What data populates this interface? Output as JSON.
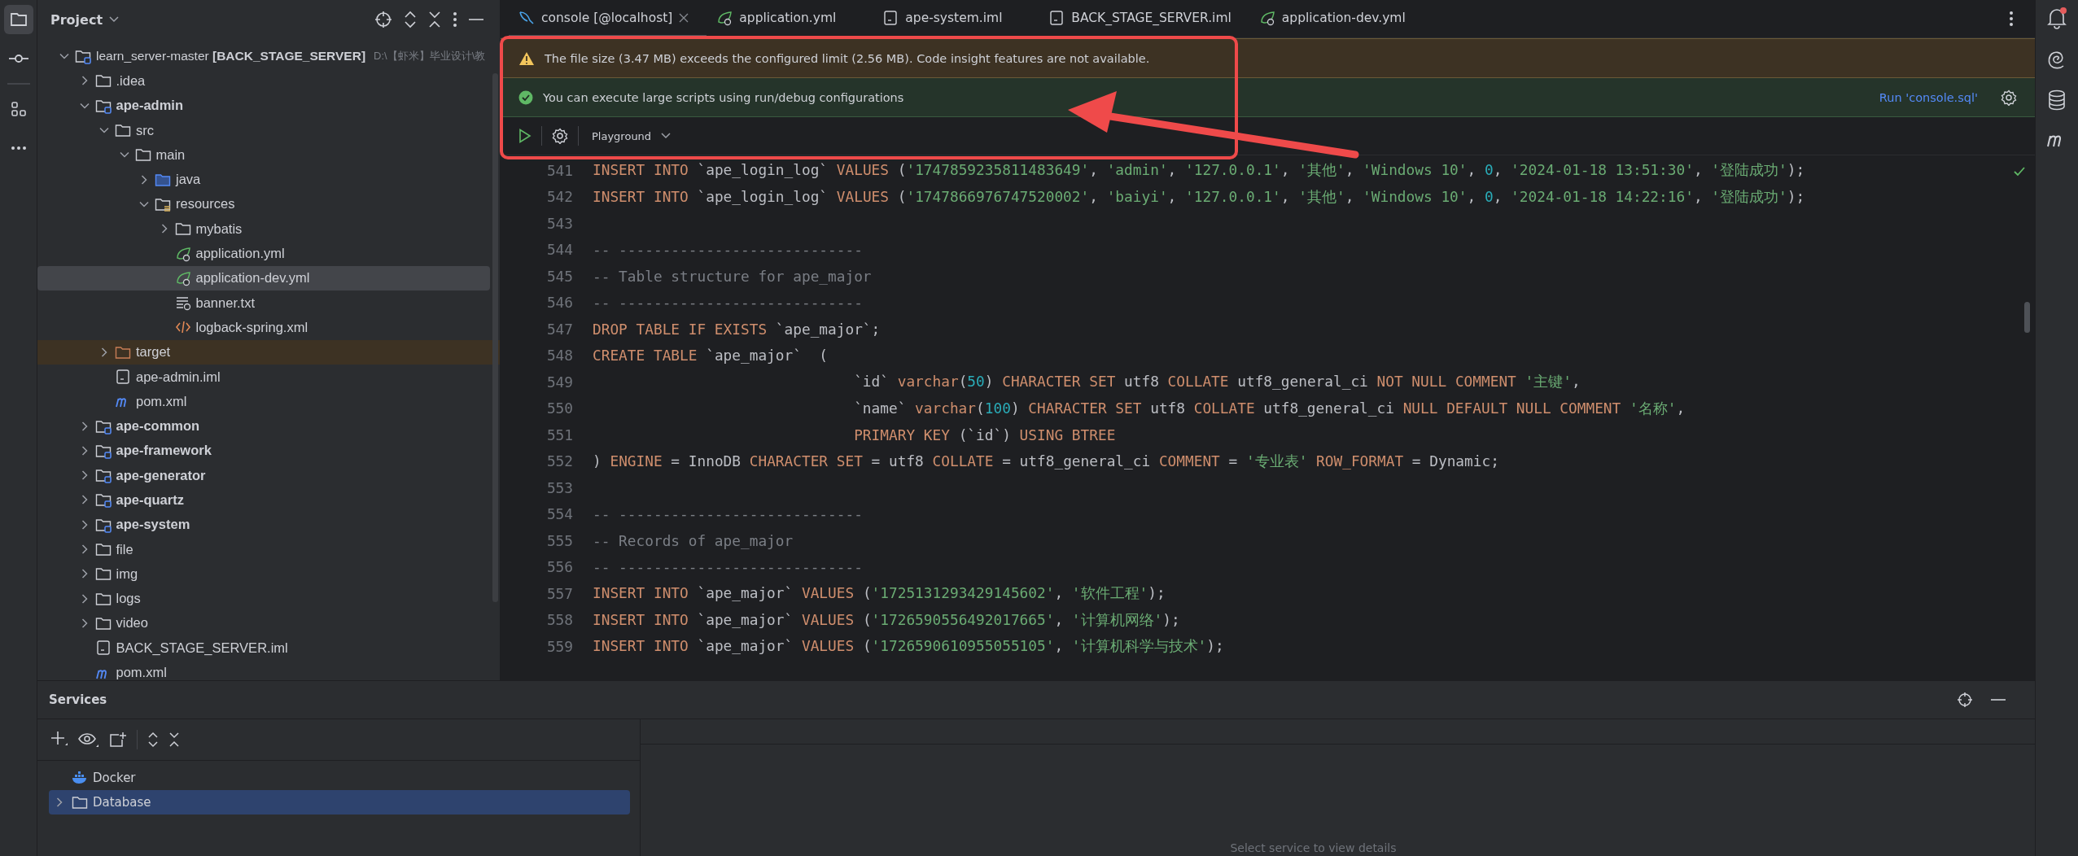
{
  "project": {
    "title": "Project",
    "tree": [
      {
        "name": "learn_server-master **[BACK_STAGE_SERVER]**",
        "location": "D:\\【虾米】毕业设计\\教",
        "kind": "project-root",
        "expanded": true,
        "selected": false,
        "children": [
          {
            "name": ".idea",
            "kind": "folder",
            "expanded": false,
            "selected": false
          },
          {
            "name": "ape-admin",
            "kind": "module",
            "expanded": true,
            "selected": false,
            "children": [
              {
                "name": "src",
                "kind": "folder",
                "expanded": true,
                "selected": false,
                "children": [
                  {
                    "name": "main",
                    "kind": "folder",
                    "expanded": true,
                    "selected": false,
                    "children": [
                      {
                        "name": "java",
                        "kind": "source",
                        "expanded": false,
                        "selected": false
                      },
                      {
                        "name": "resources",
                        "kind": "resources",
                        "expanded": true,
                        "selected": false,
                        "children": [
                          {
                            "name": "mybatis",
                            "kind": "folder",
                            "expanded": false,
                            "selected": false
                          },
                          {
                            "name": "application.yml",
                            "kind": "spring",
                            "selected": false
                          },
                          {
                            "name": "application-dev.yml",
                            "kind": "spring",
                            "selected": true
                          },
                          {
                            "name": "banner.txt",
                            "kind": "text",
                            "selected": false
                          },
                          {
                            "name": "logback-spring.xml",
                            "kind": "xml",
                            "selected": false
                          }
                        ]
                      }
                    ]
                  }
                ]
              },
              {
                "name": "target",
                "kind": "excluded",
                "expanded": false,
                "selected": false
              },
              {
                "name": "ape-admin.iml",
                "kind": "iml",
                "selected": false
              },
              {
                "name": "pom.xml",
                "kind": "maven",
                "selected": false
              }
            ]
          },
          {
            "name": "ape-common",
            "kind": "module",
            "expanded": false,
            "selected": false
          },
          {
            "name": "ape-framework",
            "kind": "module",
            "expanded": false,
            "selected": false
          },
          {
            "name": "ape-generator",
            "kind": "module",
            "expanded": false,
            "selected": false
          },
          {
            "name": "ape-quartz",
            "kind": "module",
            "expanded": false,
            "selected": false
          },
          {
            "name": "ape-system",
            "kind": "module",
            "expanded": false,
            "selected": false
          },
          {
            "name": "file",
            "kind": "folder",
            "expanded": false,
            "selected": false
          },
          {
            "name": "img",
            "kind": "folder",
            "expanded": false,
            "selected": false
          },
          {
            "name": "logs",
            "kind": "folder",
            "expanded": false,
            "selected": false
          },
          {
            "name": "video",
            "kind": "folder",
            "expanded": false,
            "selected": false
          },
          {
            "name": "BACK_STAGE_SERVER.iml",
            "kind": "iml",
            "selected": false
          },
          {
            "name": "pom.xml",
            "kind": "maven",
            "selected": false
          }
        ]
      }
    ]
  },
  "editor": {
    "tabs": [
      {
        "label": "console [@localhost]",
        "kind": "console",
        "selected": true
      },
      {
        "label": "application.yml",
        "kind": "spring",
        "selected": false
      },
      {
        "label": "ape-system.iml",
        "kind": "iml",
        "selected": false
      },
      {
        "label": "BACK_STAGE_SERVER.iml",
        "kind": "iml",
        "selected": false
      },
      {
        "label": "application-dev.yml",
        "kind": "spring",
        "selected": false
      }
    ],
    "warning_banner": {
      "text": "The file size (3.47 MB) exceeds the configured limit (2.56 MB). Code insight features are not available."
    },
    "info_banner": {
      "text": "You can execute large scripts using run/debug configurations",
      "action": "Run 'console.sql'"
    },
    "toolbar": {
      "schema": "Playground"
    },
    "code_lines": [
      {
        "number": "541",
        "tokens": [
          {
            "kind": "keyword",
            "text": "INSERT INTO"
          },
          {
            "kind": "plain",
            "text": " `ape_login_log` "
          },
          {
            "kind": "keyword",
            "text": "VALUES"
          },
          {
            "kind": "plain",
            "text": " ("
          },
          {
            "kind": "string",
            "text": "'1747859235811483649'"
          },
          {
            "kind": "plain",
            "text": ", "
          },
          {
            "kind": "string",
            "text": "'admin'"
          },
          {
            "kind": "plain",
            "text": ", "
          },
          {
            "kind": "string",
            "text": "'127.0.0.1'"
          },
          {
            "kind": "plain",
            "text": ", "
          },
          {
            "kind": "string",
            "text": "'其他'"
          },
          {
            "kind": "plain",
            "text": ", "
          },
          {
            "kind": "string",
            "text": "'Windows 10'"
          },
          {
            "kind": "plain",
            "text": ", "
          },
          {
            "kind": "number",
            "text": "0"
          },
          {
            "kind": "plain",
            "text": ", "
          },
          {
            "kind": "string",
            "text": "'2024-01-18 13:51:30'"
          },
          {
            "kind": "plain",
            "text": ", "
          },
          {
            "kind": "string",
            "text": "'登陆成功'"
          },
          {
            "kind": "plain",
            "text": ");"
          }
        ]
      },
      {
        "number": "542",
        "tokens": [
          {
            "kind": "keyword",
            "text": "INSERT INTO"
          },
          {
            "kind": "plain",
            "text": " `ape_login_log` "
          },
          {
            "kind": "keyword",
            "text": "VALUES"
          },
          {
            "kind": "plain",
            "text": " ("
          },
          {
            "kind": "string",
            "text": "'1747866976747520002'"
          },
          {
            "kind": "plain",
            "text": ", "
          },
          {
            "kind": "string",
            "text": "'baiyi'"
          },
          {
            "kind": "plain",
            "text": ", "
          },
          {
            "kind": "string",
            "text": "'127.0.0.1'"
          },
          {
            "kind": "plain",
            "text": ", "
          },
          {
            "kind": "string",
            "text": "'其他'"
          },
          {
            "kind": "plain",
            "text": ", "
          },
          {
            "kind": "string",
            "text": "'Windows 10'"
          },
          {
            "kind": "plain",
            "text": ", "
          },
          {
            "kind": "number",
            "text": "0"
          },
          {
            "kind": "plain",
            "text": ", "
          },
          {
            "kind": "string",
            "text": "'2024-01-18 14:22:16'"
          },
          {
            "kind": "plain",
            "text": ", "
          },
          {
            "kind": "string",
            "text": "'登陆成功'"
          },
          {
            "kind": "plain",
            "text": ");"
          }
        ]
      },
      {
        "number": "543"
      },
      {
        "number": "544",
        "tokens": [
          {
            "kind": "comment",
            "text": "-- ----------------------------"
          }
        ]
      },
      {
        "number": "545",
        "tokens": [
          {
            "kind": "comment",
            "text": "-- Table structure for ape_major"
          }
        ]
      },
      {
        "number": "546",
        "tokens": [
          {
            "kind": "comment",
            "text": "-- ----------------------------"
          }
        ]
      },
      {
        "number": "547",
        "tokens": [
          {
            "kind": "keyword",
            "text": "DROP TABLE IF EXISTS"
          },
          {
            "kind": "plain",
            "text": " `ape_major`;"
          }
        ]
      },
      {
        "number": "548",
        "tokens": [
          {
            "kind": "keyword",
            "text": "CREATE TABLE"
          },
          {
            "kind": "plain",
            "text": " `ape_major`  ("
          }
        ]
      },
      {
        "number": "549",
        "tokens": [
          {
            "kind": "plain",
            "text": "                              `id` "
          },
          {
            "kind": "keyword",
            "text": "varchar"
          },
          {
            "kind": "plain",
            "text": "("
          },
          {
            "kind": "number",
            "text": "50"
          },
          {
            "kind": "plain",
            "text": ") "
          },
          {
            "kind": "keyword",
            "text": "CHARACTER SET"
          },
          {
            "kind": "plain",
            "text": " utf8 "
          },
          {
            "kind": "keyword",
            "text": "COLLATE"
          },
          {
            "kind": "plain",
            "text": " utf8_general_ci "
          },
          {
            "kind": "keyword",
            "text": "NOT NULL COMMENT "
          },
          {
            "kind": "string",
            "text": "'主键'"
          },
          {
            "kind": "plain",
            "text": ","
          }
        ]
      },
      {
        "number": "550",
        "tokens": [
          {
            "kind": "plain",
            "text": "                              `name` "
          },
          {
            "kind": "keyword",
            "text": "varchar"
          },
          {
            "kind": "plain",
            "text": "("
          },
          {
            "kind": "number",
            "text": "100"
          },
          {
            "kind": "plain",
            "text": ") "
          },
          {
            "kind": "keyword",
            "text": "CHARACTER SET"
          },
          {
            "kind": "plain",
            "text": " utf8 "
          },
          {
            "kind": "keyword",
            "text": "COLLATE"
          },
          {
            "kind": "plain",
            "text": " utf8_general_ci "
          },
          {
            "kind": "keyword",
            "text": "NULL DEFAULT NULL COMMENT "
          },
          {
            "kind": "string",
            "text": "'名称'"
          },
          {
            "kind": "plain",
            "text": ","
          }
        ]
      },
      {
        "number": "551",
        "tokens": [
          {
            "kind": "keyword",
            "text": "                              PRIMARY KEY"
          },
          {
            "kind": "plain",
            "text": " (`id`) "
          },
          {
            "kind": "keyword",
            "text": "USING BTREE"
          }
        ]
      },
      {
        "number": "552",
        "tokens": [
          {
            "kind": "plain",
            "text": ") "
          },
          {
            "kind": "keyword",
            "text": "ENGINE"
          },
          {
            "kind": "plain",
            "text": " = InnoDB "
          },
          {
            "kind": "keyword",
            "text": "CHARACTER SET"
          },
          {
            "kind": "plain",
            "text": " = utf8 "
          },
          {
            "kind": "keyword",
            "text": "COLLATE"
          },
          {
            "kind": "plain",
            "text": " = utf8_general_ci "
          },
          {
            "kind": "keyword",
            "text": "COMMENT"
          },
          {
            "kind": "plain",
            "text": " = "
          },
          {
            "kind": "string",
            "text": "'专业表'"
          },
          {
            "kind": "keyword",
            "text": " ROW_FORMAT"
          },
          {
            "kind": "plain",
            "text": " = Dynamic;"
          }
        ]
      },
      {
        "number": "553"
      },
      {
        "number": "554",
        "tokens": [
          {
            "kind": "comment",
            "text": "-- ----------------------------"
          }
        ]
      },
      {
        "number": "555",
        "tokens": [
          {
            "kind": "comment",
            "text": "-- Records of ape_major"
          }
        ]
      },
      {
        "number": "556",
        "tokens": [
          {
            "kind": "comment",
            "text": "-- ----------------------------"
          }
        ]
      },
      {
        "number": "557",
        "tokens": [
          {
            "kind": "keyword",
            "text": "INSERT INTO"
          },
          {
            "kind": "plain",
            "text": " `ape_major` "
          },
          {
            "kind": "keyword",
            "text": "VALUES"
          },
          {
            "kind": "plain",
            "text": " ("
          },
          {
            "kind": "string",
            "text": "'1725131293429145602'"
          },
          {
            "kind": "plain",
            "text": ", "
          },
          {
            "kind": "string",
            "text": "'软件工程'"
          },
          {
            "kind": "plain",
            "text": ");"
          }
        ]
      },
      {
        "number": "558",
        "tokens": [
          {
            "kind": "keyword",
            "text": "INSERT INTO"
          },
          {
            "kind": "plain",
            "text": " `ape_major` "
          },
          {
            "kind": "keyword",
            "text": "VALUES"
          },
          {
            "kind": "plain",
            "text": " ("
          },
          {
            "kind": "string",
            "text": "'1726590556492017665'"
          },
          {
            "kind": "plain",
            "text": ", "
          },
          {
            "kind": "string",
            "text": "'计算机网络'"
          },
          {
            "kind": "plain",
            "text": ");"
          }
        ]
      },
      {
        "number": "559",
        "tokens": [
          {
            "kind": "keyword",
            "text": "INSERT INTO"
          },
          {
            "kind": "plain",
            "text": " `ape_major` "
          },
          {
            "kind": "keyword",
            "text": "VALUES"
          },
          {
            "kind": "plain",
            "text": " ("
          },
          {
            "kind": "string",
            "text": "'1726590610955055105'"
          },
          {
            "kind": "plain",
            "text": ", "
          },
          {
            "kind": "string",
            "text": "'计算机科学与技术'"
          },
          {
            "kind": "plain",
            "text": ");"
          }
        ]
      }
    ]
  },
  "services": {
    "title": "Services",
    "items": [
      {
        "name": "Docker",
        "kind": "docker",
        "selected": false
      },
      {
        "name": "Database",
        "kind": "folder",
        "expanded": false,
        "selected": true
      }
    ],
    "detail_hint": "Select service to view details"
  }
}
